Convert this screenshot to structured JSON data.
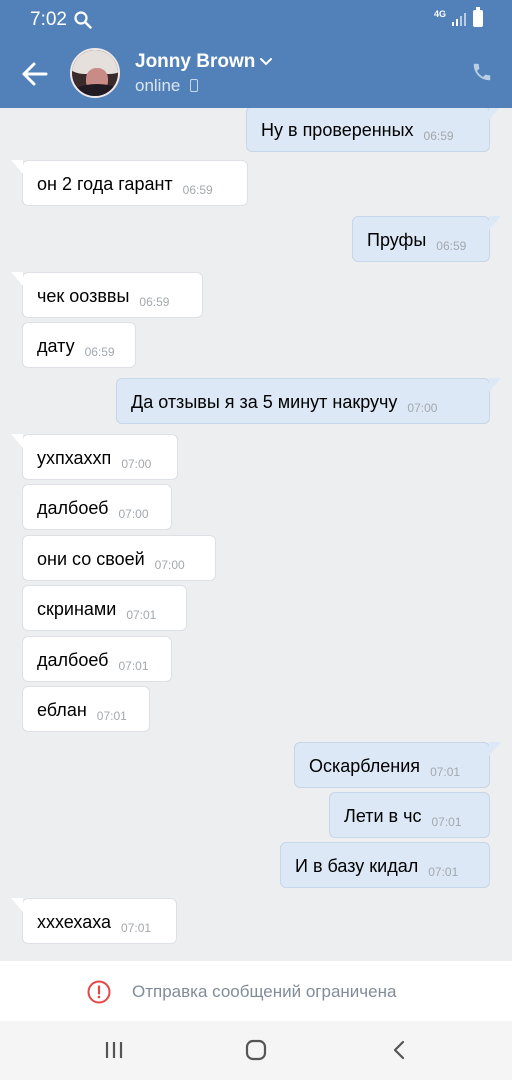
{
  "status_bar": {
    "time": "7:02",
    "network": "4G"
  },
  "header": {
    "contact_name": "Jonny Brown",
    "presence": "online"
  },
  "messages": [
    {
      "dir": "out",
      "text": "Ну в проверенных",
      "time": "06:59"
    },
    {
      "dir": "in",
      "text": "он 2 года гарант",
      "time": "06:59"
    },
    {
      "dir": "out",
      "text": "Пруфы",
      "time": "06:59"
    },
    {
      "dir": "in",
      "text": "чек оозввы",
      "time": "06:59"
    },
    {
      "dir": "in",
      "text": "дату",
      "time": "06:59"
    },
    {
      "dir": "out",
      "text": "Да отзывы я за 5 минут накручу",
      "time": "07:00"
    },
    {
      "dir": "in",
      "text": "ухпхаххп",
      "time": "07:00"
    },
    {
      "dir": "in",
      "text": "далбоеб",
      "time": "07:00"
    },
    {
      "dir": "in",
      "text": "они со своей",
      "time": "07:00"
    },
    {
      "dir": "in",
      "text": "скринами",
      "time": "07:01"
    },
    {
      "dir": "in",
      "text": "далбоеб",
      "time": "07:01"
    },
    {
      "dir": "in",
      "text": "еблан",
      "time": "07:01"
    },
    {
      "dir": "out",
      "text": "Оскарбления",
      "time": "07:01"
    },
    {
      "dir": "out",
      "text": "Лети в чс",
      "time": "07:01"
    },
    {
      "dir": "out",
      "text": "И в базу кидал",
      "time": "07:01"
    },
    {
      "dir": "in",
      "text": "хххехаха",
      "time": "07:01"
    }
  ],
  "restricted": {
    "text": "Отправка сообщений ограничена"
  },
  "colors": {
    "header": "#5181b8",
    "incoming": "#ffffff",
    "outgoing": "#dce8f6",
    "background": "#edeef0",
    "warning": "#e64646"
  }
}
